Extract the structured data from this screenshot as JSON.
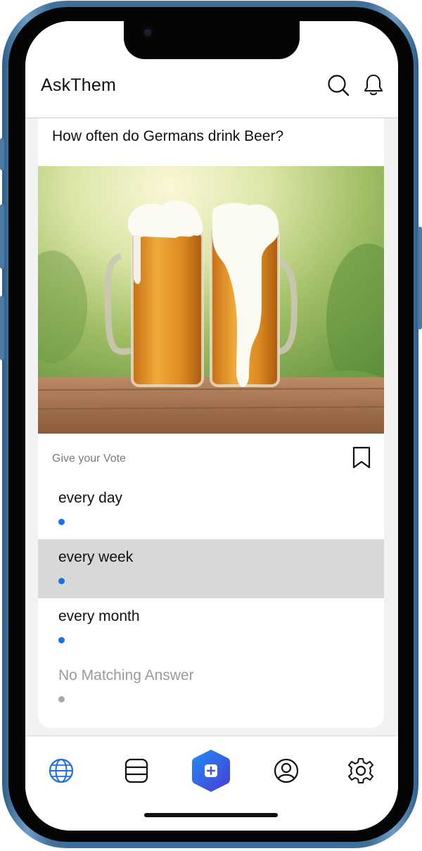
{
  "app": {
    "title": "AskThem"
  },
  "header": {
    "icons": [
      "search-icon",
      "bell-icon"
    ]
  },
  "poll": {
    "question": "How often do Germans drink Beer?",
    "image": "two-beer-mugs-on-wooden-table",
    "vote_label": "Give your Vote",
    "options": [
      {
        "label": "every day",
        "selected": false
      },
      {
        "label": "every week",
        "selected": true
      },
      {
        "label": "every month",
        "selected": false
      }
    ],
    "no_match_label": "No Matching Answer"
  },
  "tabbar": {
    "items": [
      "globe-icon",
      "list-icon",
      "add-post-icon",
      "profile-icon",
      "settings-icon"
    ],
    "active": "globe-icon"
  },
  "colors": {
    "accent": "#1e6ee8",
    "selected_row": "#d8d8d8",
    "fab_gradient": [
      "#1f8ef1",
      "#4a3ad8"
    ]
  }
}
